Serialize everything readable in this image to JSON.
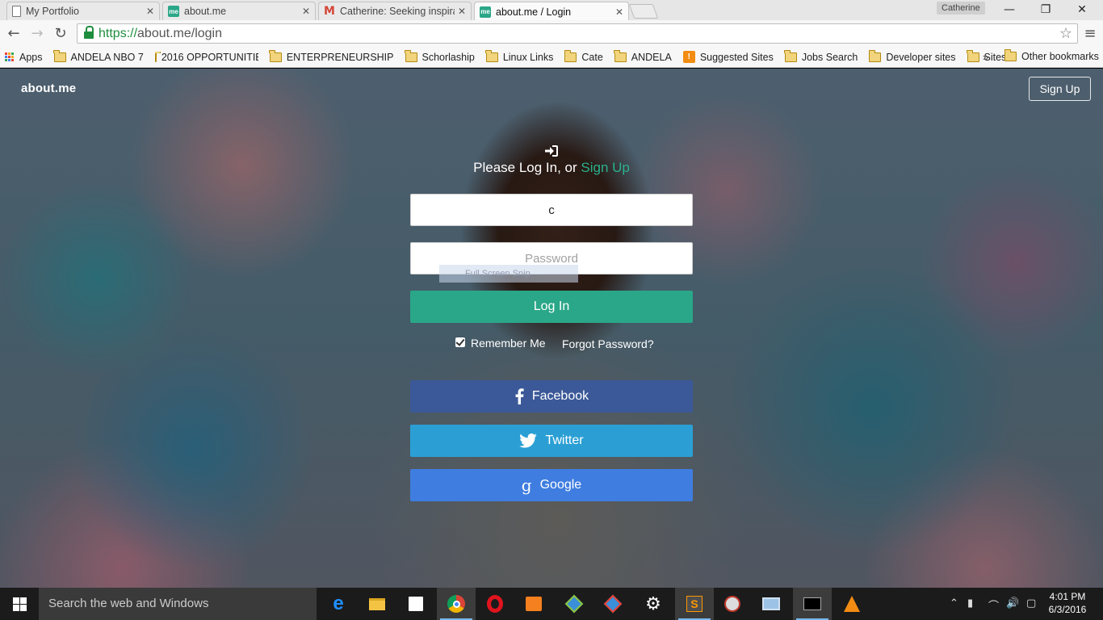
{
  "browser": {
    "tabs": [
      {
        "title": "My Portfolio",
        "favicon": "document-icon"
      },
      {
        "title": "about.me",
        "favicon": "aboutme-icon"
      },
      {
        "title": "Catherine: Seeking inspira",
        "favicon": "gmail-icon"
      },
      {
        "title": "about.me / Login",
        "favicon": "aboutme-icon",
        "active": true
      }
    ],
    "tab_close": "✕",
    "profile_name": "Catherine",
    "url_scheme": "https://",
    "url_rest": "about.me/login",
    "bookmarks": [
      {
        "label": "Apps",
        "type": "apps"
      },
      {
        "label": "ANDELA NBO 7",
        "type": "folder"
      },
      {
        "label": "2016 OPPORTUNITIES",
        "type": "folder"
      },
      {
        "label": "ENTERPRENEURSHIP",
        "type": "folder"
      },
      {
        "label": "Schorlaship",
        "type": "folder"
      },
      {
        "label": "Linux Links",
        "type": "folder"
      },
      {
        "label": "Cate",
        "type": "folder"
      },
      {
        "label": "ANDELA",
        "type": "folder"
      },
      {
        "label": "Suggested Sites",
        "type": "site"
      },
      {
        "label": "Jobs Search",
        "type": "folder"
      },
      {
        "label": "Developer sites",
        "type": "folder"
      },
      {
        "label": "Sites",
        "type": "folder"
      }
    ],
    "bookmarks_more": "»",
    "other_bookmarks": "Other bookmarks"
  },
  "page": {
    "logo": "about.me",
    "signup_top": "Sign Up",
    "heading_prefix": "Please Log In, or ",
    "heading_link": "Sign Up",
    "username_value": "c",
    "password_placeholder": "Password",
    "ghost_tooltip": "Full Screen Snip",
    "login_button": "Log In",
    "remember_me": "Remember Me",
    "remember_checked": true,
    "forgot_password": "Forgot Password?",
    "facebook": "Facebook",
    "twitter": "Twitter",
    "google": "Google",
    "accent_color": "#2aa788"
  },
  "taskbar": {
    "search_placeholder": "Search the web and Windows",
    "time": "4:01 PM",
    "date": "6/3/2016"
  }
}
